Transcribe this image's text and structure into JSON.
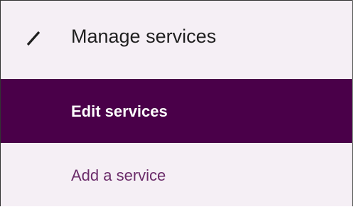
{
  "header": {
    "icon": "pencil-icon",
    "title": "Manage services"
  },
  "menu": {
    "items": [
      {
        "label": "Edit services",
        "active": true
      },
      {
        "label": "Add a service",
        "active": false
      }
    ]
  },
  "colors": {
    "panel_background": "#f5eff5",
    "active_background": "#4a0049",
    "active_text": "#ffffff",
    "link_text": "#6b2c6a",
    "title_text": "#1f1f1f"
  }
}
